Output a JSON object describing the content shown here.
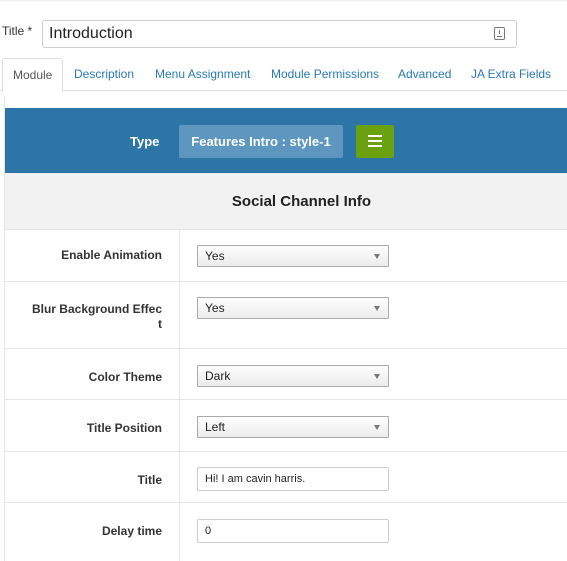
{
  "title_field": {
    "label": "Title *",
    "value": "Introduction"
  },
  "tabs": [
    {
      "label": "Module",
      "active": true
    },
    {
      "label": "Description"
    },
    {
      "label": "Menu Assignment"
    },
    {
      "label": "Module Permissions"
    },
    {
      "label": "Advanced"
    },
    {
      "label": "JA Extra Fields"
    }
  ],
  "type_bar": {
    "label": "Type",
    "value": "Features Intro : style-1",
    "button_icon": "list-icon",
    "color": "#2e75a7",
    "button_color": "#6aa20f"
  },
  "section": {
    "heading": "Social Channel Info"
  },
  "fields": {
    "enable_animation": {
      "label": "Enable Animation",
      "value": "Yes"
    },
    "blur_background": {
      "label_line1": "Blur Background Effec",
      "label_line2": "t",
      "value": "Yes"
    },
    "color_theme": {
      "label": "Color Theme",
      "value": "Dark"
    },
    "title_position": {
      "label": "Title Position",
      "value": "Left"
    },
    "title": {
      "label": "Title",
      "value": "Hi! I am cavin harris."
    },
    "delay_time": {
      "label": "Delay time",
      "value": "0"
    }
  }
}
